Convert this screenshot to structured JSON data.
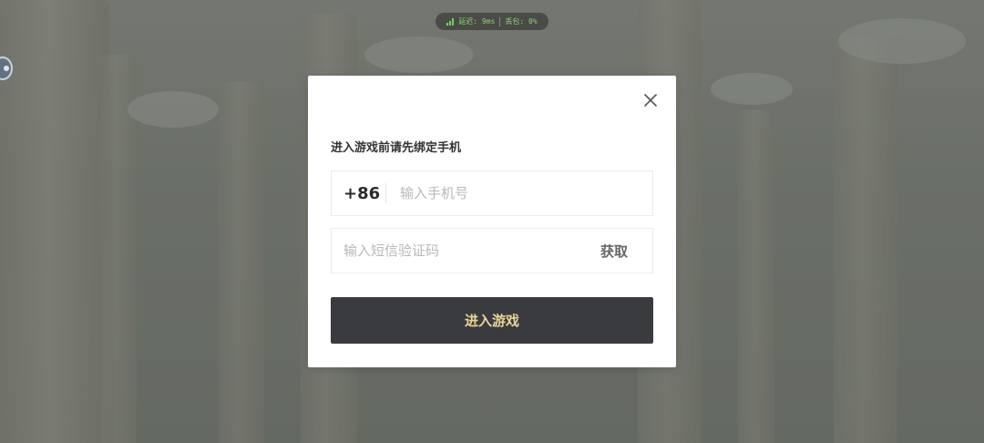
{
  "status_bar": {
    "latency_label": "延迟: 9ms",
    "packet_loss_label": "丢包: 0%",
    "signal_icon": "signal-bars-icon",
    "signal_color": "#6fd35a"
  },
  "dialog": {
    "title": "进入游戏前请先绑定手机",
    "close_icon": "close-icon",
    "phone": {
      "country_code": "+86",
      "placeholder": "输入手机号",
      "value": ""
    },
    "code": {
      "placeholder": "输入短信验证码",
      "value": "",
      "get_code_label": "获取"
    },
    "submit_label": "进入游戏",
    "colors": {
      "submit_background": "#393b3e",
      "submit_text": "#ecd39a"
    }
  }
}
